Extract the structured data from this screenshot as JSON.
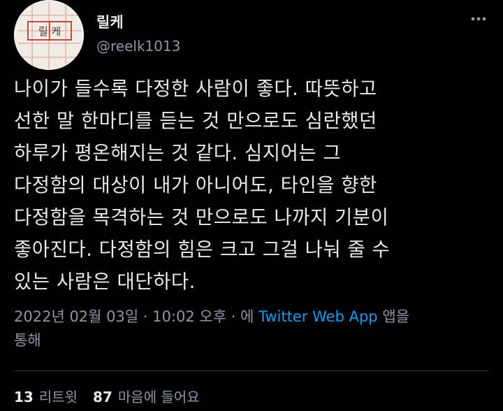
{
  "author": {
    "display_name": "릴케",
    "handle": "@reelk1013",
    "avatar_text": "릴 케"
  },
  "tweet": {
    "text": "나이가 들수록 다정한 사람이 좋다.  따뜻하고\n선한 말 한마디를 듣는 것 만으로도 심란했던\n하루가 평온해지는 것 같다. 심지어는 그\n다정함의 대상이 내가 아니어도, 타인을 향한\n다정함을 목격하는 것 만으로도 나까지 기분이\n좋아진다. 다정함의 힘은 크고 그걸 나눠 줄 수\n있는 사람은 대단하다."
  },
  "meta": {
    "timestamp": "2022년 02월 03일 · 10:02 오후 · ",
    "via_prefix": "에 ",
    "source": "Twitter Web App",
    "via_suffix": " 앱을\n통해"
  },
  "stats": {
    "retweets_count": "13",
    "retweets_label": "리트윗",
    "likes_count": "87",
    "likes_label": "마음에 들어요"
  },
  "icons": {
    "more": "more-horizontal-icon"
  },
  "colors": {
    "background": "#000000",
    "text": "#e7e9ea",
    "secondary": "#8b98a5",
    "link": "#1d9bf0",
    "divider": "#2f3336",
    "avatar_bg": "#f2ece6",
    "avatar_border": "#c0392b"
  }
}
